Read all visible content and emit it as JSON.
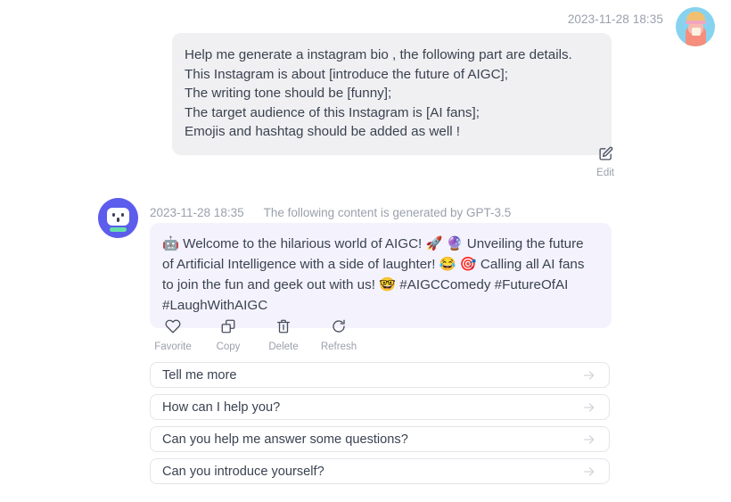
{
  "user_message": {
    "timestamp": "2023-11-28 18:35",
    "avatar_name": "user-avatar",
    "text": "Help me generate a instagram bio , the following part are details.\nThis Instagram is about [introduce the future of AIGC];\nThe writing tone should be [funny];\nThe target audience of this Instagram is [AI fans];\nEmojis and hashtag should be added as well !",
    "edit_label": "Edit",
    "bubble_color": "#f0f0f2"
  },
  "assistant_message": {
    "timestamp": "2023-11-28 18:35",
    "generated_by": "The following content is generated by GPT-3.5",
    "text": "🤖 Welcome to the hilarious world of AIGC! 🚀 🔮 Unveiling the future of Artificial Intelligence with a side of laughter! 😂 🎯 Calling all AI fans to join the fun and geek out with us! 🤓 #AIGCComedy #FutureOfAI #LaughWithAIGC",
    "bubble_color": "#f4f3fd",
    "avatar_color": "#5c5ced",
    "actions": [
      {
        "label": "Favorite",
        "icon": "heart-icon"
      },
      {
        "label": "Copy",
        "icon": "copy-icon"
      },
      {
        "label": "Delete",
        "icon": "trash-icon"
      },
      {
        "label": "Refresh",
        "icon": "refresh-icon"
      }
    ]
  },
  "suggestions": [
    {
      "label": "Tell me more"
    },
    {
      "label": "How can I help you?"
    },
    {
      "label": "Can you help me answer some questions?"
    },
    {
      "label": "Can you introduce yourself?"
    }
  ],
  "colors": {
    "text": "#3a4251",
    "muted": "#9aa0ac",
    "border": "#e3e5ea",
    "accent": "#5c5ced"
  }
}
